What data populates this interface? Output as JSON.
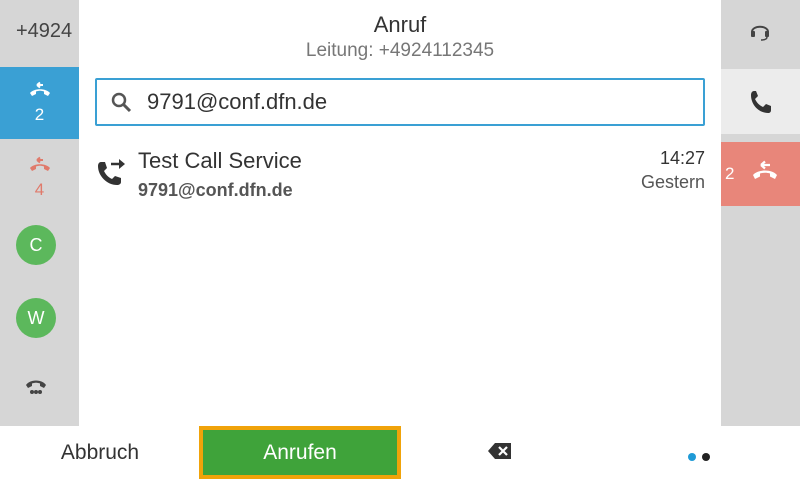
{
  "left_strip": {
    "number": "+4924",
    "active_line": {
      "count": "2",
      "icon": "hangup-icon"
    },
    "alert_line": {
      "count": "4",
      "icon": "hangup-icon"
    },
    "avatars": [
      "C",
      "W"
    ],
    "voicemail_icon": "voicemail-icon"
  },
  "header": {
    "title": "Anruf",
    "subtitle": "Leitung: +4924112345"
  },
  "search": {
    "value": "9791@conf.dfn.de",
    "icon": "search-icon"
  },
  "results": [
    {
      "name": "Test Call Service",
      "address": "9791@conf.dfn.de",
      "time": "14:27",
      "date": "Gestern",
      "icon": "outgoing-call-icon"
    }
  ],
  "right_strip": {
    "headset_icon": "headset-icon",
    "phone_icon": "phone-icon",
    "held": {
      "count": "2",
      "icon": "hangup-icon"
    }
  },
  "softkeys": {
    "cancel": "Abbruch",
    "call": "Anrufen",
    "backspace_icon": "backspace-icon"
  },
  "colors": {
    "accent": "#3aa0d4",
    "call_green": "#3fa33a",
    "focus_orange": "#f0a30a",
    "held_red": "#e8867a",
    "avatar_green": "#5cb85c"
  }
}
